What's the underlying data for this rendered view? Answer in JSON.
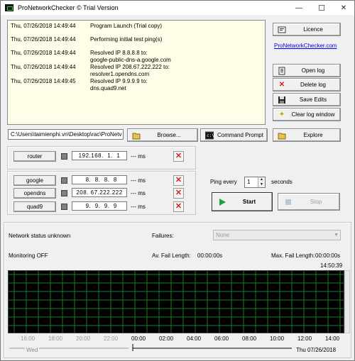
{
  "window": {
    "title": "ProNetworkChecker © Trial Version",
    "minimize": "—",
    "maximize": "☐",
    "close": "✕"
  },
  "log": [
    {
      "ts": "Thu, 07/26/2018 14:49:44",
      "msg": "Program Launch (Trial copy)"
    },
    {
      "ts": "Thu, 07/26/2018 14:49:44",
      "msg": "Performing initial test ping(s)"
    },
    {
      "ts": "Thu, 07/26/2018 14:49:44",
      "msg": "Resolved IP 8.8.8.8 to:\ngoogle-public-dns-a.google.com"
    },
    {
      "ts": "Thu, 07/26/2018 14:49:44",
      "msg": "Resolved IP 208.67.222.222 to:\nresolver1.opendns.com"
    },
    {
      "ts": "Thu, 07/26/2018 14:49:45",
      "msg": "Resolved IP 9.9.9.9 to:\ndns.quad9.net"
    }
  ],
  "buttons": {
    "licence": "Licence",
    "website": "ProNetworkChecker.com",
    "open_log": "Open log",
    "delete_log": "Delete log",
    "save_edits": "Save Edits",
    "clear_log": "Clear log window",
    "browse": "Browse...",
    "command_prompt": "Command Prompt",
    "explore": "Explore",
    "start": "Start",
    "stop": "Stop"
  },
  "path": "C:\\Users\\taimienphi.vn\\Desktop\\rac\\ProNetv",
  "hosts": [
    {
      "name": "router",
      "ip": "192.168.  1.  1",
      "ms": "--- ms"
    },
    {
      "name": "google",
      "ip": "  8.  8.  8.  8",
      "ms": "--- ms"
    },
    {
      "name": "opendns",
      "ip": "208. 67.222.222",
      "ms": "--- ms"
    },
    {
      "name": "quad9",
      "ip": "  9.  9.  9.  9",
      "ms": "--- ms"
    }
  ],
  "ping": {
    "label": "Ping every",
    "value": "1",
    "unit": "seconds"
  },
  "status": {
    "network": "Network status unknown",
    "failures_label": "Failures:",
    "failures_value": "None",
    "monitoring": "Monitoring OFF",
    "avg_label": "Av. Fail Length:",
    "avg_value": "00:00:00s",
    "max_label": "Max. Fail Length:",
    "max_value": "00:00:00s",
    "current_time": "14:50:39"
  },
  "timeline": {
    "prev_labels": [
      "16:00",
      "18:00",
      "20:00",
      "22:00"
    ],
    "labels": [
      "00:00",
      "02:00",
      "04:00",
      "06:00",
      "08:00",
      "10:00",
      "12:00",
      "14:00"
    ],
    "prev_day": "Wed",
    "day": "Thu 07/26/2018"
  },
  "colors": {
    "grid": "#1a7a2a",
    "log_bg": "#fefee8",
    "delete_icon": "#d42020",
    "start_icon": "#1fa040"
  }
}
